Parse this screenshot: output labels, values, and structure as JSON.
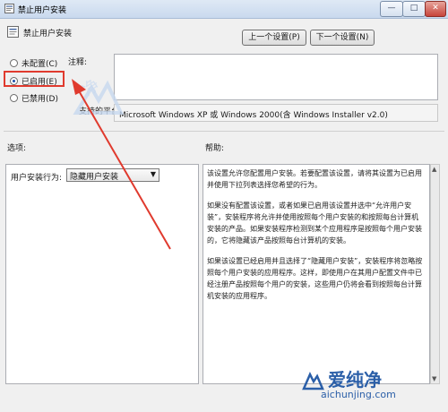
{
  "window": {
    "title": "禁止用户安装",
    "controls": {
      "minimize": "—",
      "maximize": "□",
      "close": "✕"
    }
  },
  "policy": {
    "name": "禁止用户安装"
  },
  "nav": {
    "prev": "上一个设置(P)",
    "next": "下一个设置(N)"
  },
  "state": {
    "options": [
      {
        "label": "未配置(C)",
        "selected": false
      },
      {
        "label": "已启用(E)",
        "selected": true
      },
      {
        "label": "已禁用(D)",
        "selected": false
      }
    ]
  },
  "comment": {
    "label": "注释:",
    "value": ""
  },
  "platform": {
    "label": "支持的平台:",
    "value": "Microsoft Windows XP 或 Windows 2000(含 Windows Installer v2.0)"
  },
  "sections": {
    "options": "选项:",
    "help": "帮助:"
  },
  "options_pane": {
    "behavior_label": "用户安装行为:",
    "behavior_value": "隐藏用户安装"
  },
  "help": {
    "paragraphs": [
      "该设置允许您配置用户安装。若要配置该设置，请将其设置为已启用并使用下拉列表选择您希望的行为。",
      "如果没有配置该设置，或者如果已启用该设置并选中“允许用户安装”，安装程序将允许并使用按照每个用户安装的和按照每台计算机安装的产品。如果安装程序检测到某个应用程序是按照每个用户安装的，它将隐藏该产品按照每台计算机的安装。",
      "如果该设置已经启用并且选择了“隐藏用户安装”，安装程序将忽略按照每个用户安装的应用程序。这样，即使用户在其用户配置文件中已经注册产品按照每个用户的安装，这些用户仍将会看到按照每台计算机安装的应用程序。"
    ]
  },
  "watermark": {
    "text": "净",
    "brand": "爱纯净",
    "url": "aichunjing.com"
  },
  "colors": {
    "highlight": "#e03a2e",
    "brand": "#2b5fa8"
  }
}
